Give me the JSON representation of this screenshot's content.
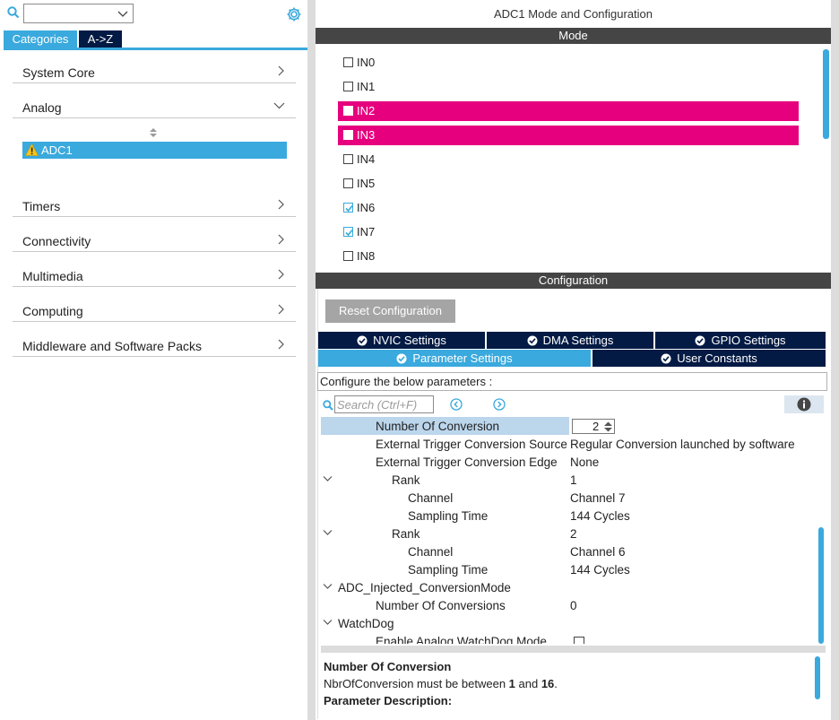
{
  "left": {
    "search_value": "",
    "tabs": {
      "categories": "Categories",
      "az": "A->Z"
    },
    "categories": [
      {
        "label": "System Core",
        "expanded": false
      },
      {
        "label": "Analog",
        "expanded": true
      },
      {
        "label": "Timers",
        "expanded": false
      },
      {
        "label": "Connectivity",
        "expanded": false
      },
      {
        "label": "Multimedia",
        "expanded": false
      },
      {
        "label": "Computing",
        "expanded": false
      },
      {
        "label": "Middleware and Software Packs",
        "expanded": false
      }
    ],
    "selected_peripheral": "ADC1"
  },
  "right": {
    "title": "ADC1 Mode and Configuration",
    "mode_header": "Mode",
    "inputs": [
      {
        "label": "IN0",
        "checked": false,
        "highlight": false
      },
      {
        "label": "IN1",
        "checked": false,
        "highlight": false
      },
      {
        "label": "IN2",
        "checked": false,
        "highlight": true
      },
      {
        "label": "IN3",
        "checked": false,
        "highlight": true
      },
      {
        "label": "IN4",
        "checked": false,
        "highlight": false
      },
      {
        "label": "IN5",
        "checked": false,
        "highlight": false
      },
      {
        "label": "IN6",
        "checked": true,
        "highlight": false
      },
      {
        "label": "IN7",
        "checked": true,
        "highlight": false
      },
      {
        "label": "IN8",
        "checked": false,
        "highlight": false
      }
    ],
    "config_header": "Configuration",
    "reset_button": "Reset Configuration",
    "tabs": {
      "nvic": "NVIC Settings",
      "dma": "DMA Settings",
      "gpio": "GPIO Settings",
      "params": "Parameter Settings",
      "constants": "User Constants"
    },
    "hint": "Configure the below parameters :",
    "search_placeholder": "Search (Ctrl+F)",
    "params": {
      "noc_key": "Number Of Conversion",
      "noc_val": "2",
      "ext_src_key": "External Trigger Conversion Source",
      "ext_src_val": "Regular Conversion launched by software",
      "ext_edge_key": "External Trigger Conversion Edge",
      "ext_edge_val": "None",
      "rank1_key": "Rank",
      "rank1_val": "1",
      "ch1_key": "Channel",
      "ch1_val": "Channel 7",
      "st1_key": "Sampling Time",
      "st1_val": "144 Cycles",
      "rank2_key": "Rank",
      "rank2_val": "2",
      "ch2_key": "Channel",
      "ch2_val": "Channel 6",
      "st2_key": "Sampling Time",
      "st2_val": "144 Cycles",
      "inj_key": "ADC_Injected_ConversionMode",
      "inj_noc_key": "Number Of Conversions",
      "inj_noc_val": "0",
      "wd_key": "WatchDog",
      "wd_enable_key": "Enable Analog WatchDog Mode"
    },
    "description": {
      "title": "Number Of Conversion",
      "line_prefix": "NbrOfConversion must be between ",
      "min": "1",
      "and": " and ",
      "max": "16",
      "suffix": ".",
      "section": "Parameter Description:"
    }
  },
  "colors": {
    "accent": "#3aa9dd",
    "dark_tab": "#031a44",
    "highlight": "#e6007e",
    "section_bar": "#454545"
  }
}
